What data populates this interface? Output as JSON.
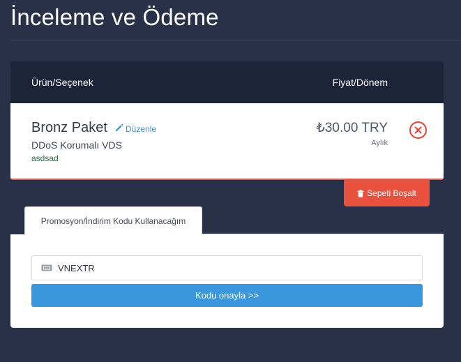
{
  "page": {
    "title": "İnceleme ve Ödeme"
  },
  "cart": {
    "headers": {
      "product": "Ürün/Seçenek",
      "price": "Fiyat/Dönem"
    },
    "items": [
      {
        "name": "Bronz Paket",
        "edit_label": "Düzenle",
        "group": "DDoS Korumalı VDS",
        "domain": "asdsad",
        "price": "₺30.00 TRY",
        "cycle": "Aylık"
      }
    ],
    "empty_cart_label": "Sepeti Boşalt"
  },
  "promo": {
    "tab_label": "Promosyon/İndirim Kodu Kullanacağım",
    "code_value": "VNEXTR",
    "validate_label": "Kodu onayla >>"
  },
  "colors": {
    "background": "#283147",
    "header": "#1b2439",
    "accent_blue": "#3a97de",
    "danger_red": "#e9513f"
  }
}
